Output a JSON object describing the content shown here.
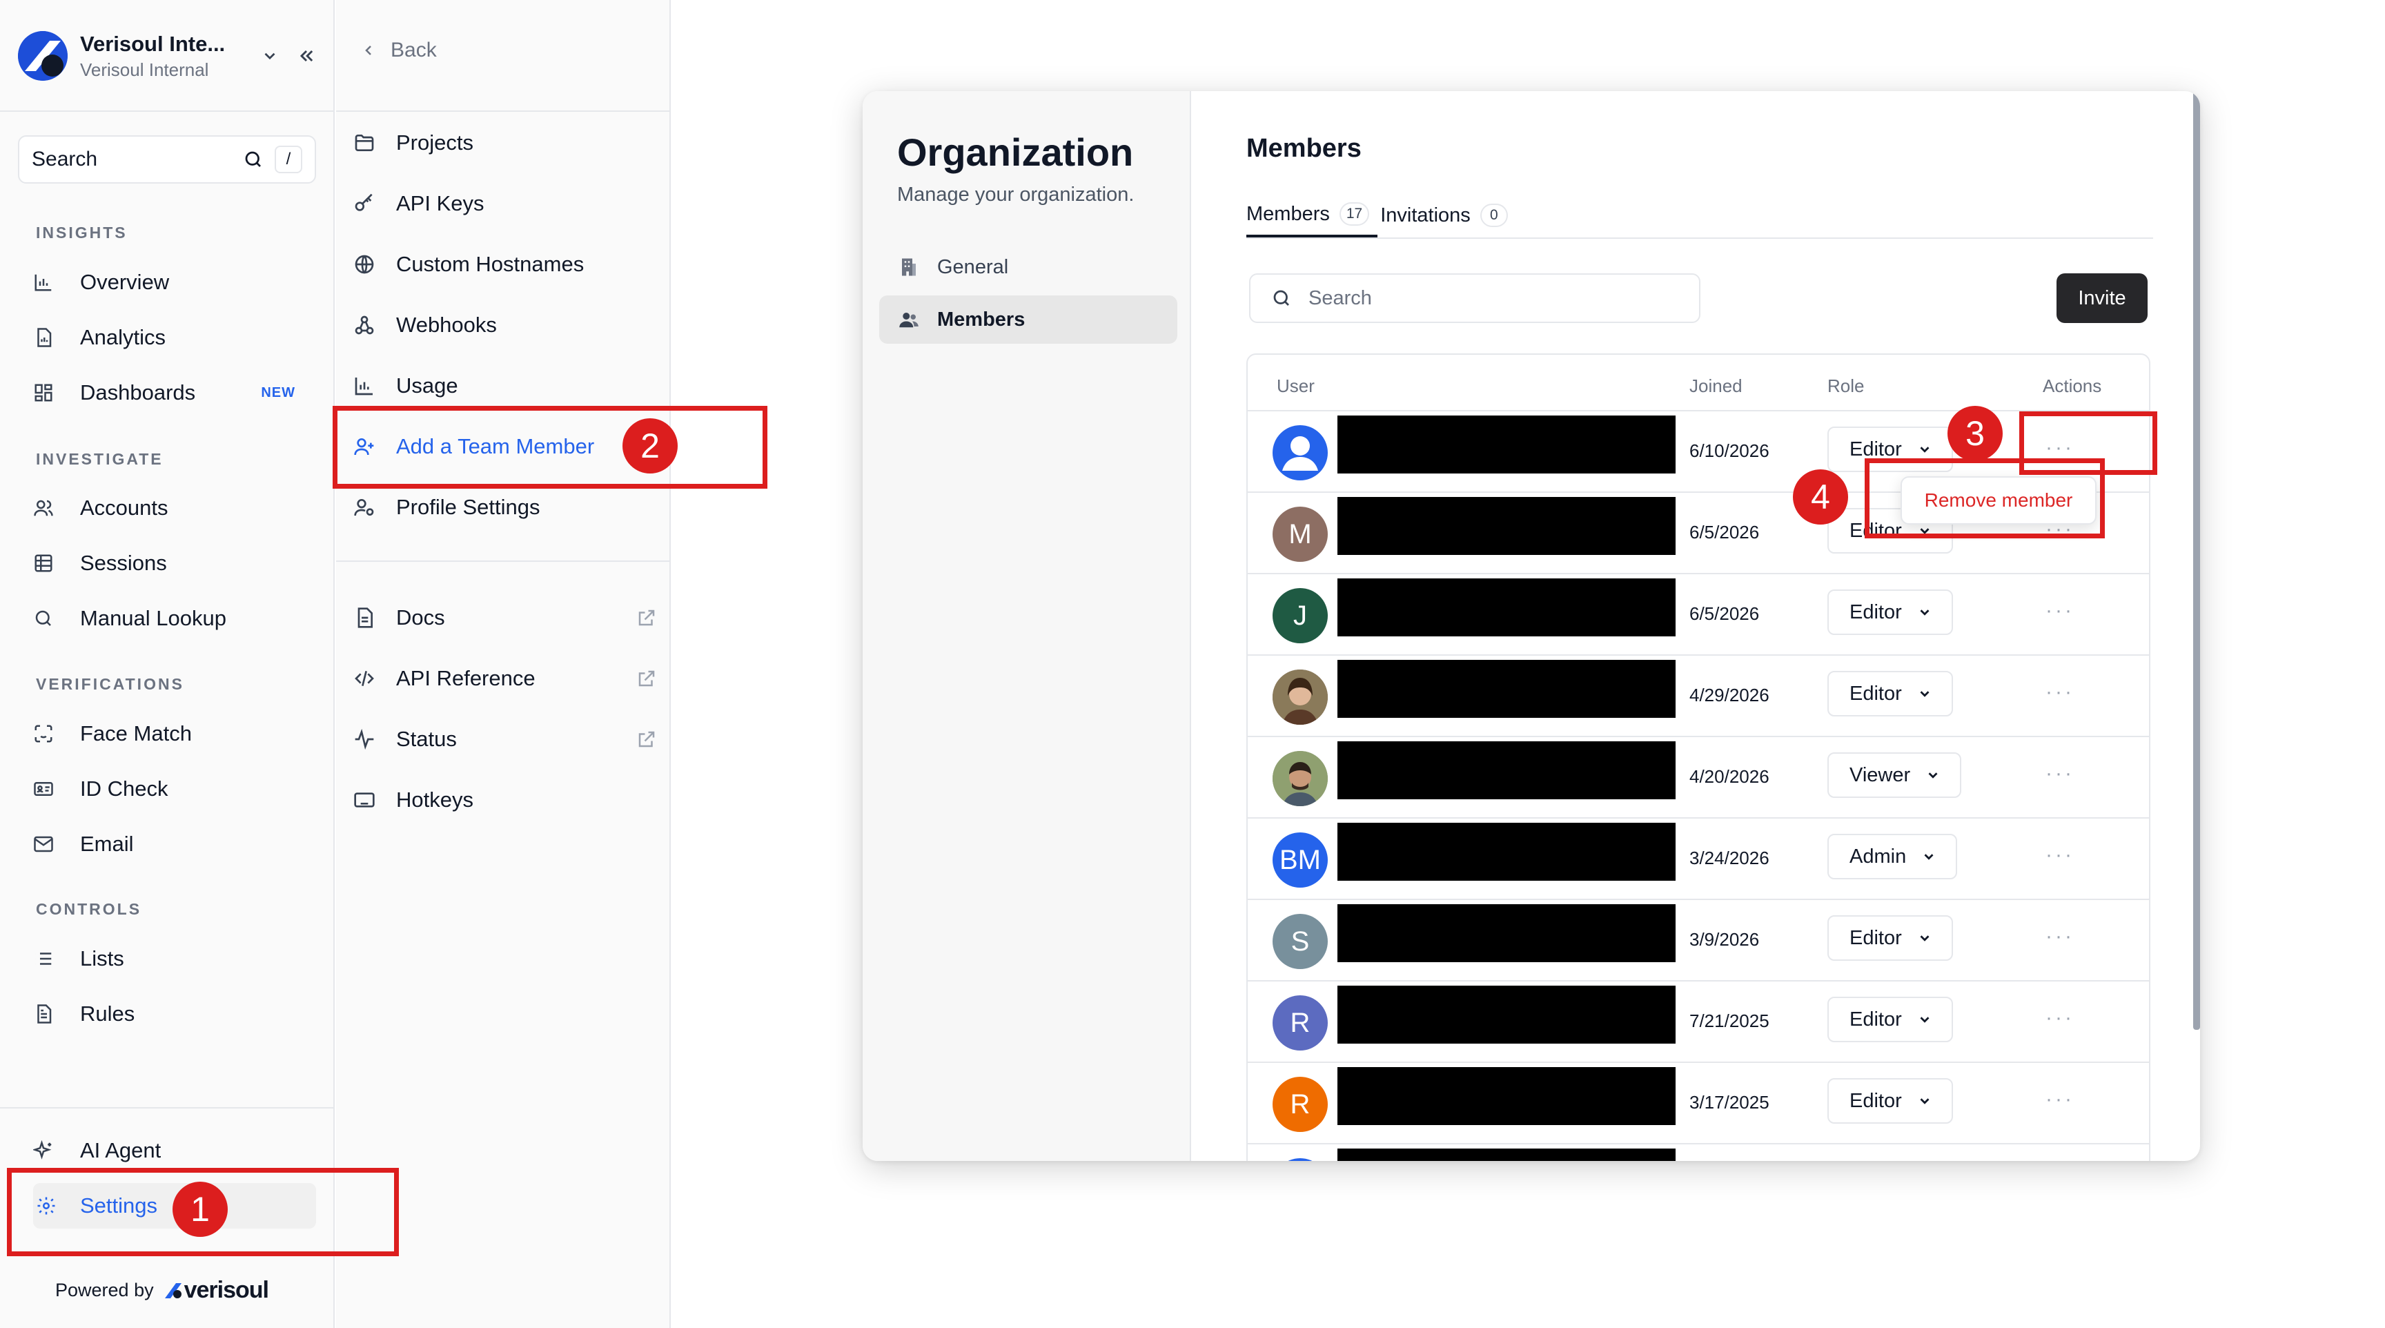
{
  "sidebar": {
    "org_name": "Verisoul Inte...",
    "org_sub": "Verisoul Internal",
    "search_label": "Search",
    "search_shortcut": "/",
    "sections": [
      {
        "label": "INSIGHTS"
      },
      {
        "label": "INVESTIGATE"
      },
      {
        "label": "VERIFICATIONS"
      },
      {
        "label": "CONTROLS"
      }
    ],
    "items": [
      {
        "label": "Overview",
        "icon": "bar-chart-icon"
      },
      {
        "label": "Analytics",
        "icon": "file-chart-icon"
      },
      {
        "label": "Dashboards",
        "icon": "grid-icon",
        "badge": "NEW"
      },
      {
        "label": "Accounts",
        "icon": "users-icon"
      },
      {
        "label": "Sessions",
        "icon": "table-icon"
      },
      {
        "label": "Manual Lookup",
        "icon": "search-icon"
      },
      {
        "label": "Face Match",
        "icon": "face-scan-icon"
      },
      {
        "label": "ID Check",
        "icon": "id-card-icon"
      },
      {
        "label": "Email",
        "icon": "mail-icon"
      },
      {
        "label": "Lists",
        "icon": "list-icon"
      },
      {
        "label": "Rules",
        "icon": "rules-icon"
      }
    ],
    "ai_agent": "AI Agent",
    "settings": "Settings",
    "powered_by": "Powered by",
    "brand": "verisoul"
  },
  "settings_nav": {
    "back": "Back",
    "items": [
      {
        "label": "Projects",
        "icon": "folder-icon"
      },
      {
        "label": "API Keys",
        "icon": "key-icon"
      },
      {
        "label": "Custom Hostnames",
        "icon": "globe-icon"
      },
      {
        "label": "Webhooks",
        "icon": "webhook-icon"
      },
      {
        "label": "Usage",
        "icon": "bar-chart-icon"
      },
      {
        "label": "Add a Team Member",
        "icon": "user-plus-icon",
        "active": true
      },
      {
        "label": "Profile Settings",
        "icon": "user-settings-icon"
      }
    ],
    "links": [
      {
        "label": "Docs",
        "icon": "doc-icon"
      },
      {
        "label": "API Reference",
        "icon": "code-icon"
      },
      {
        "label": "Status",
        "icon": "activity-icon"
      },
      {
        "label": "Hotkeys",
        "icon": "keyboard-icon"
      }
    ]
  },
  "annotations": [
    "1",
    "2",
    "3",
    "4"
  ],
  "organization": {
    "title": "Organization",
    "description": "Manage your organization.",
    "nav": [
      {
        "label": "General",
        "icon": "building-icon"
      },
      {
        "label": "Members",
        "icon": "users-icon",
        "active": true
      }
    ],
    "members_title": "Members",
    "tabs": [
      {
        "label": "Members",
        "count": "17"
      },
      {
        "label": "Invitations",
        "count": "0"
      }
    ],
    "search_placeholder": "Search",
    "invite_label": "Invite",
    "columns": [
      "User",
      "Joined",
      "Role",
      "Actions"
    ],
    "rows": [
      {
        "avatar": "",
        "avatar_color": "#2563eb",
        "joined": "6/10/2026",
        "role": "Editor"
      },
      {
        "avatar": "M",
        "avatar_color": "#8d6e63",
        "joined": "6/5/2026",
        "role": "Editor"
      },
      {
        "avatar": "J",
        "avatar_color": "#1f5a43",
        "joined": "6/5/2026",
        "role": "Editor"
      },
      {
        "avatar": "",
        "avatar_color": "#6b4f3a",
        "joined": "4/29/2026",
        "role": "Editor"
      },
      {
        "avatar": "",
        "avatar_color": "#7a8a6a",
        "joined": "4/20/2026",
        "role": "Viewer"
      },
      {
        "avatar": "BM",
        "avatar_color": "#2563eb",
        "joined": "3/24/2026",
        "role": "Admin"
      },
      {
        "avatar": "S",
        "avatar_color": "#78909c",
        "joined": "3/9/2026",
        "role": "Editor"
      },
      {
        "avatar": "R",
        "avatar_color": "#5c6bc0",
        "joined": "7/21/2025",
        "role": "Editor"
      },
      {
        "avatar": "R",
        "avatar_color": "#ef6c00",
        "joined": "3/17/2025",
        "role": "Editor"
      },
      {
        "avatar": "",
        "avatar_color": "#2563eb",
        "joined": "",
        "role": ""
      }
    ],
    "row_menu": {
      "remove": "Remove member"
    }
  },
  "colors": {
    "accent": "#2563eb",
    "annotation_red": "#dc1e1e",
    "danger": "#dc2626"
  }
}
